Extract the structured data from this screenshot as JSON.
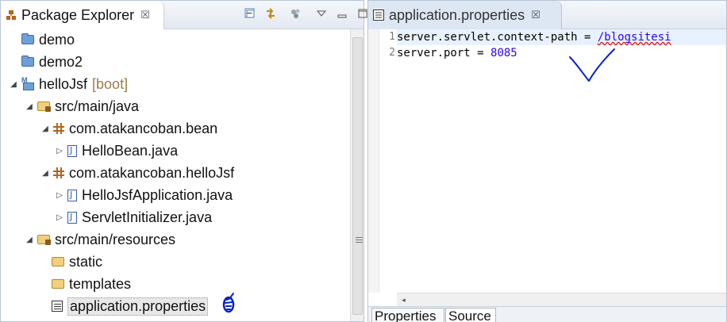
{
  "package_explorer": {
    "tab_title": "Package Explorer",
    "tab_close": "☒",
    "toolbar_icons": [
      "collapse-all-icon",
      "link-with-editor-icon",
      "focus-icon",
      "view-menu-icon",
      "minimize-icon",
      "maximize-icon"
    ],
    "tree": [
      {
        "label": "demo",
        "icon": "project-icon",
        "arrow": ""
      },
      {
        "label": "demo2",
        "icon": "project-icon",
        "arrow": ""
      },
      {
        "label": "helloJsf",
        "decoration": "[boot]",
        "icon": "boot-project-icon",
        "arrow": "◢"
      },
      {
        "label": "src/main/java",
        "icon": "source-folder-icon",
        "arrow": "◢"
      },
      {
        "label": "com.atakancoban.bean",
        "icon": "package-icon",
        "arrow": "◢"
      },
      {
        "label": "HelloBean.java",
        "icon": "java-file-icon",
        "arrow": "▷"
      },
      {
        "label": "com.atakancoban.helloJsf",
        "icon": "package-icon",
        "arrow": "◢"
      },
      {
        "label": "HelloJsfApplication.java",
        "icon": "java-file-icon",
        "arrow": "▷"
      },
      {
        "label": "ServletInitializer.java",
        "icon": "java-file-icon",
        "arrow": "▷"
      },
      {
        "label": "src/main/resources",
        "icon": "source-folder-icon",
        "arrow": "◢"
      },
      {
        "label": "static",
        "icon": "folder-icon",
        "arrow": ""
      },
      {
        "label": "templates",
        "icon": "folder-icon",
        "arrow": ""
      },
      {
        "label": "application.properties",
        "icon": "properties-file-icon",
        "arrow": "",
        "selected": true
      }
    ]
  },
  "editor": {
    "tab_title": "application.properties",
    "tab_close": "☒",
    "lines": [
      {
        "number": "1",
        "key": "server.servlet.context-path",
        "sep": " = ",
        "value": "/blogsitesi"
      },
      {
        "number": "2",
        "key": "server.port",
        "sep": " = ",
        "value": "8085"
      }
    ],
    "bottom_tabs": [
      "Properties",
      "Source"
    ],
    "scroll_left": "◂"
  },
  "colors": {
    "value_text": "#2a00ff",
    "annotation_ink": "#0a22c8",
    "current_line": "#e8f2fe",
    "decoration": "#9b7b4a"
  }
}
